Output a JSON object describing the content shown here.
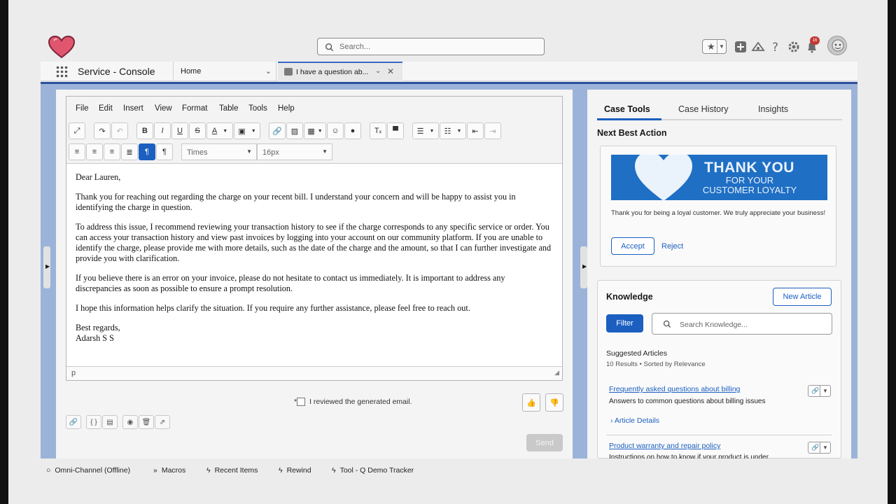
{
  "header": {
    "search_placeholder": "Search...",
    "notification_count": "16"
  },
  "nav": {
    "app_name": "Service - Console",
    "tabs": [
      {
        "label": "Home"
      },
      {
        "label": "I have a question ab..."
      }
    ]
  },
  "editor": {
    "menu": [
      "File",
      "Edit",
      "Insert",
      "View",
      "Format",
      "Table",
      "Tools",
      "Help"
    ],
    "font_family": "Times",
    "font_size": "16px",
    "body": [
      "Dear Lauren,",
      "Thank you for reaching out regarding the charge on your recent bill. I understand your concern and will be happy to assist you in identifying the charge in question.",
      "To address this issue, I recommend reviewing your transaction history to see if the charge corresponds to any specific service or order. You can access your transaction history and view past invoices by logging into your account on our community platform. If you are unable to identify the charge, please provide me with more details, such as the date of the charge and the amount, so that I can further investigate and provide you with clarification.",
      "If you believe there is an error on your invoice, please do not hesitate to contact us immediately. It is important to address any discrepancies as soon as possible to ensure a prompt resolution.",
      "I hope this information helps clarify the situation. If you require any further assistance, please feel free to reach out."
    ],
    "closing": "Best regards,",
    "signature": "Adarsh S S",
    "status_path": "p",
    "review_asterisk": "*",
    "review_label": "I reviewed the generated email.",
    "send_label": "Send"
  },
  "case_tools": {
    "tabs": [
      "Case Tools",
      "Case History",
      "Insights"
    ],
    "nba_title": "Next Best Action",
    "banner_line1": "THANK YOU",
    "banner_line2": "FOR YOUR",
    "banner_line3": "CUSTOMER LOYALTY",
    "offer_text": "Thank you for being a loyal customer. We truly appreciate your business!",
    "accept_label": "Accept",
    "reject_label": "Reject",
    "knowledge_title": "Knowledge",
    "new_article_label": "New Article",
    "filter_label": "Filter",
    "knowledge_search_placeholder": "Search Knowledge...",
    "suggested_label": "Suggested Articles",
    "results_text": "10 Results • Sorted by Relevance",
    "articles": [
      {
        "title": "Frequently asked questions about billing",
        "desc": "Answers to common questions about billing issues",
        "details": "Article Details"
      },
      {
        "title": "Product warranty and repair policy",
        "desc": "Instructions on how to know if your product is under"
      }
    ]
  },
  "utility_bar": [
    {
      "label": "Omni-Channel (Offline)"
    },
    {
      "label": "Macros"
    },
    {
      "label": "Recent Items"
    },
    {
      "label": "Rewind"
    },
    {
      "label": "Tool - Q Demo Tracker"
    }
  ],
  "colors": {
    "brand_blue": "#1b5fc0",
    "workspace_blue": "#9bb3d8",
    "heart": "#e0566f"
  }
}
